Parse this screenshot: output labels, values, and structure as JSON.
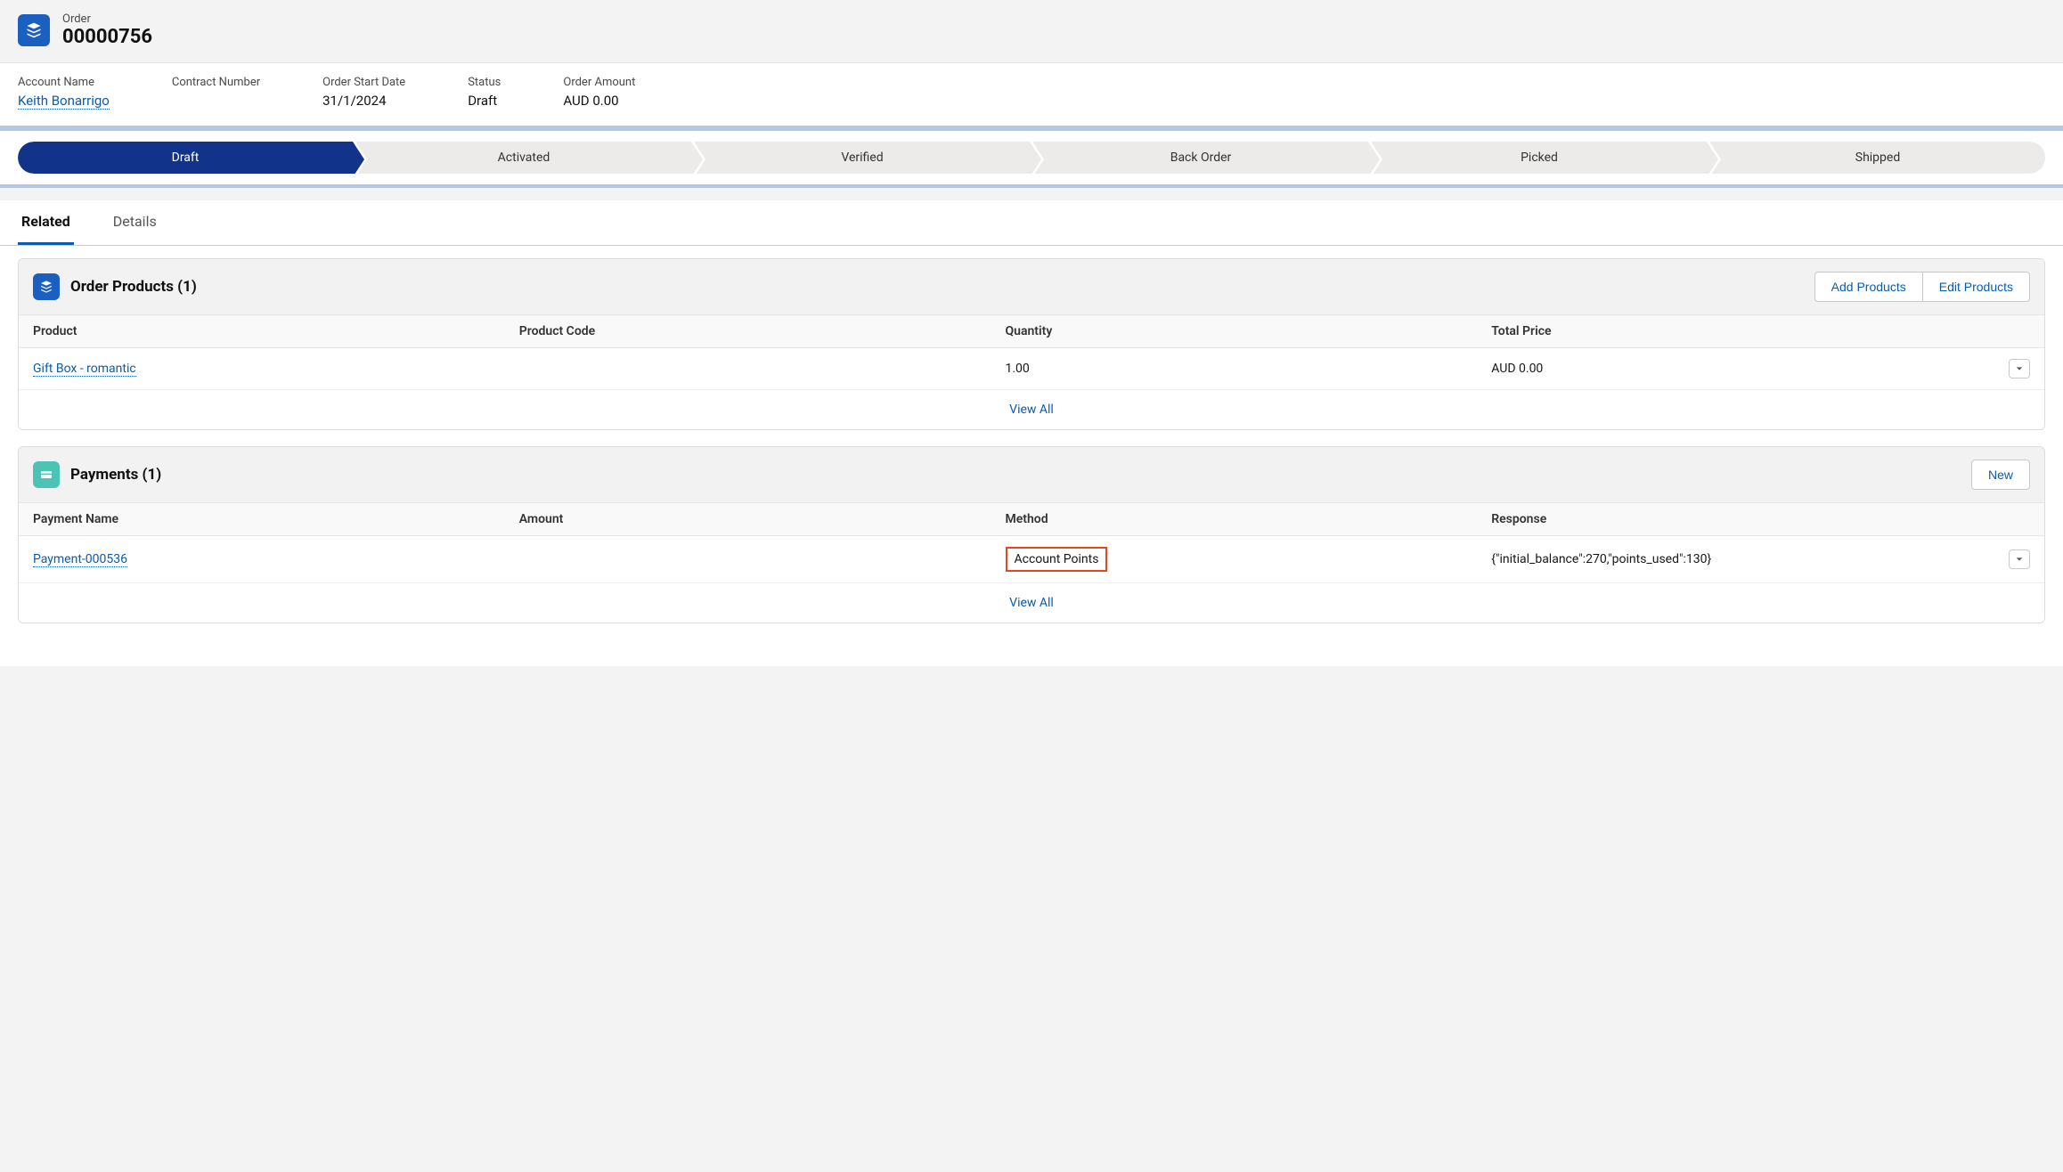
{
  "header": {
    "object_label": "Order",
    "record_number": "00000756"
  },
  "highlights": {
    "account_name": {
      "label": "Account Name",
      "value": "Keith Bonarrigo"
    },
    "contract_number": {
      "label": "Contract Number",
      "value": ""
    },
    "order_start_date": {
      "label": "Order Start Date",
      "value": "31/1/2024"
    },
    "status": {
      "label": "Status",
      "value": "Draft"
    },
    "order_amount": {
      "label": "Order Amount",
      "value": "AUD 0.00"
    }
  },
  "path": {
    "stages": [
      "Draft",
      "Activated",
      "Verified",
      "Back Order",
      "Picked",
      "Shipped"
    ],
    "current_index": 0
  },
  "tabs": {
    "items": [
      "Related",
      "Details"
    ],
    "active_index": 0
  },
  "order_products": {
    "title": "Order Products (1)",
    "actions": {
      "add": "Add Products",
      "edit": "Edit Products"
    },
    "columns": [
      "Product",
      "Product Code",
      "Quantity",
      "Total Price"
    ],
    "rows": [
      {
        "product": "Gift Box - romantic",
        "product_code": "",
        "quantity": "1.00",
        "total_price": "AUD 0.00"
      }
    ],
    "view_all": "View All"
  },
  "payments": {
    "title": "Payments (1)",
    "actions": {
      "new": "New"
    },
    "columns": [
      "Payment Name",
      "Amount",
      "Method",
      "Response"
    ],
    "rows": [
      {
        "name": "Payment-000536",
        "amount": "",
        "method": "Account Points",
        "response": "{\"initial_balance\":270,\"points_used\":130}"
      }
    ],
    "view_all": "View All"
  }
}
